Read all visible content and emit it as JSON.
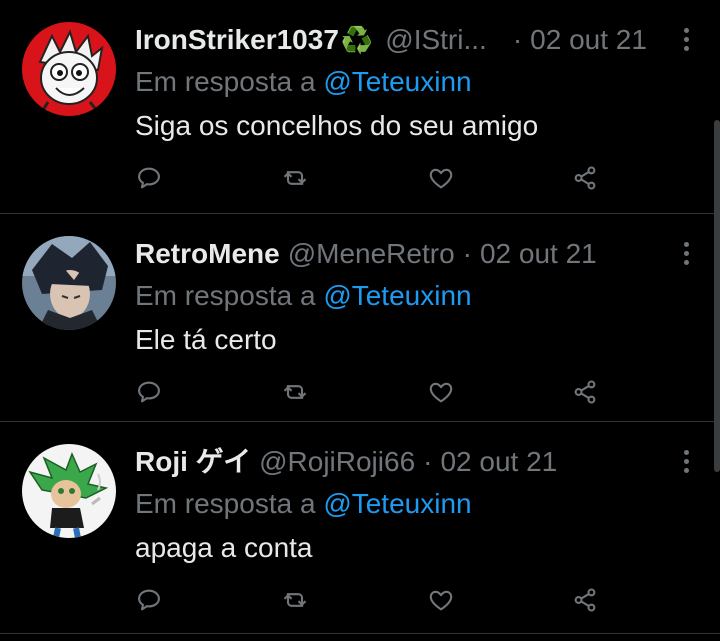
{
  "colors": {
    "background": "#000000",
    "text": "#e7e9ea",
    "muted": "#71767b",
    "mention": "#1d9bf0",
    "divider": "#2f3336",
    "recycle_emoji": "#3fb24a"
  },
  "icons": {
    "reply": "speech-bubble-icon",
    "retweet": "retweet-icon",
    "like": "heart-icon",
    "share": "share-icon",
    "more": "more-vertical-icon",
    "name_emoji": "recycle-emoji"
  },
  "tweets": [
    {
      "name": "IronStriker1037",
      "name_emoji": "♻️",
      "handle": "@IStri...",
      "dot": "·",
      "date": "02 out 21",
      "reply_prefix": "Em resposta a",
      "reply_mention": "@Teteuxinn",
      "text": "Siga os concelhos do seu amigo"
    },
    {
      "name": "RetroMene",
      "handle": "@MeneRetro",
      "dot": "·",
      "date": "02 out 21",
      "reply_prefix": "Em resposta a",
      "reply_mention": "@Teteuxinn",
      "text": "Ele tá certo"
    },
    {
      "name": "Roji ゲイ",
      "handle": "@RojiRoji66",
      "dot": "·",
      "date": "02 out 21",
      "reply_prefix": "Em resposta a",
      "reply_mention": "@Teteuxinn",
      "text": "apaga a conta"
    }
  ]
}
